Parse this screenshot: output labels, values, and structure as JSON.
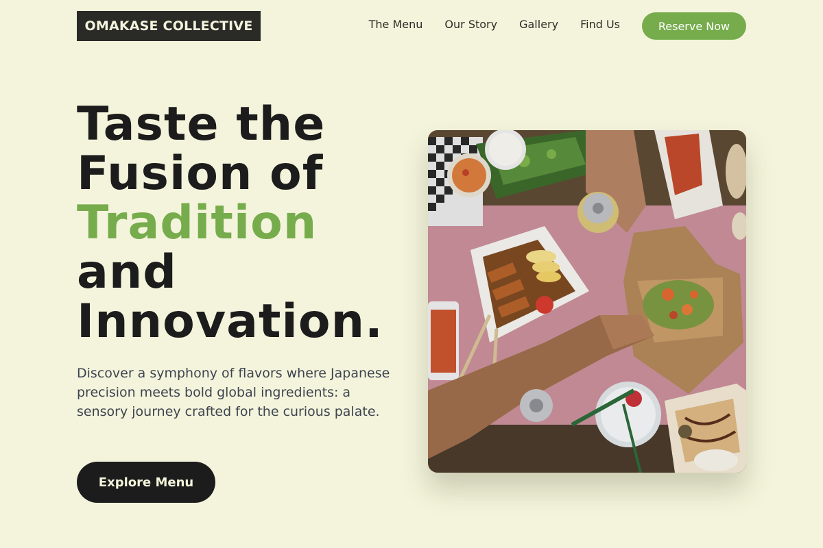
{
  "brand": {
    "name": "OMAKASE COLLECTIVE"
  },
  "nav": {
    "links": [
      "The Menu",
      "Our Story",
      "Gallery",
      "Find Us"
    ],
    "cta": "Reserve Now"
  },
  "hero": {
    "title_lines": [
      "Taste the",
      "Fusion of",
      "Tradition",
      "and",
      "Innovation."
    ],
    "description": "Discover a symphony of flavors where Japanese precision meets bold global ingredients: a sensory journey crafted for the curious palate.",
    "cta": "Explore Menu",
    "image_icon": "food-photo-icon"
  },
  "colors": {
    "background": "#f4f4dc",
    "accent": "#76ac4c",
    "dark": "#1c1c1c"
  }
}
